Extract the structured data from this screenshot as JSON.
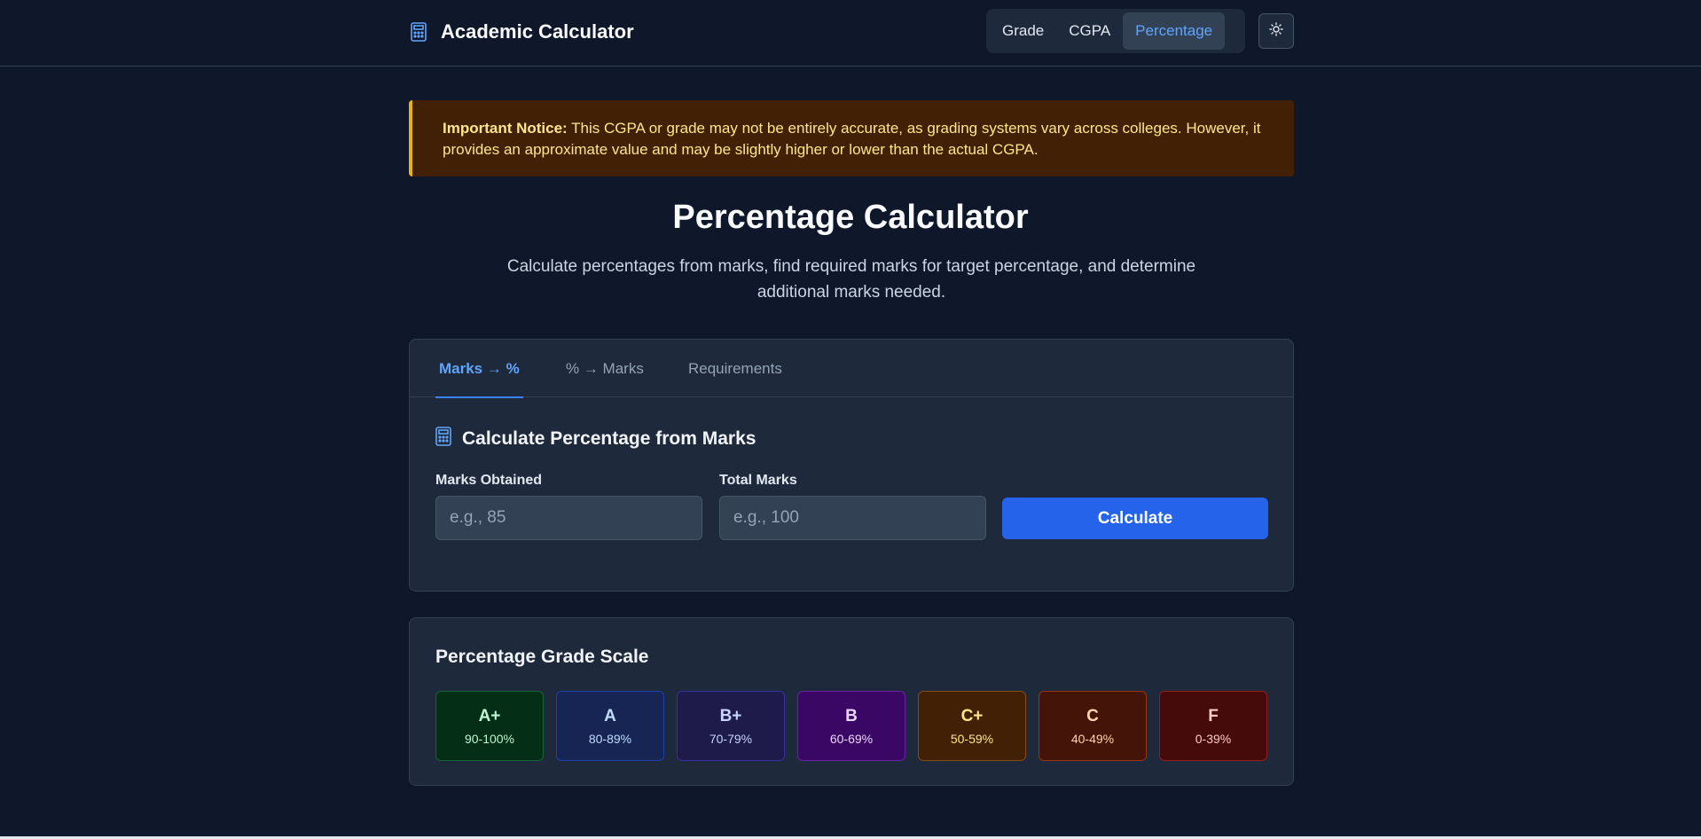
{
  "header": {
    "title": "Academic Calculator",
    "nav": [
      {
        "label": "Grade",
        "active": false
      },
      {
        "label": "CGPA",
        "active": false
      },
      {
        "label": "Percentage",
        "active": true
      }
    ],
    "theme_icon": "sun-icon"
  },
  "notice": {
    "label": "Important Notice:",
    "text": " This CGPA or grade may not be entirely accurate, as grading systems vary across colleges. However, it provides an approximate value and may be slightly higher or lower than the actual CGPA."
  },
  "page": {
    "title": "Percentage Calculator",
    "subtitle": "Calculate percentages from marks, find required marks for target percentage, and determine additional marks needed."
  },
  "calculator": {
    "tabs": [
      {
        "label": "Marks → %",
        "active": true
      },
      {
        "label": "% → Marks",
        "active": false
      },
      {
        "label": "Requirements",
        "active": false
      }
    ],
    "section_title": "Calculate Percentage from Marks",
    "marks_obtained_label": "Marks Obtained",
    "marks_obtained_placeholder": "e.g., 85",
    "marks_obtained_value": "",
    "total_marks_label": "Total Marks",
    "total_marks_placeholder": "e.g., 100",
    "total_marks_value": "",
    "calculate_label": "Calculate"
  },
  "scale": {
    "title": "Percentage Grade Scale",
    "grades": [
      {
        "grade": "A+",
        "range": "90-100%",
        "bg": "#052e16",
        "border": "#166534",
        "fg": "#bbf7d0"
      },
      {
        "grade": "A",
        "range": "80-89%",
        "bg": "#172554",
        "border": "#1e40af",
        "fg": "#bfdbfe"
      },
      {
        "grade": "B+",
        "range": "70-79%",
        "bg": "#1e1b4b",
        "border": "#3730a3",
        "fg": "#c7d2fe"
      },
      {
        "grade": "B",
        "range": "60-69%",
        "bg": "#3b0764",
        "border": "#6b21a8",
        "fg": "#e9d5ff"
      },
      {
        "grade": "C+",
        "range": "50-59%",
        "bg": "#422006",
        "border": "#854d0e",
        "fg": "#fde68a"
      },
      {
        "grade": "C",
        "range": "40-49%",
        "bg": "#431407",
        "border": "#9a3412",
        "fg": "#fed7aa"
      },
      {
        "grade": "F",
        "range": "0-39%",
        "bg": "#450a0a",
        "border": "#991b1b",
        "fg": "#fecaca"
      }
    ]
  },
  "colors": {
    "accent": "#60a5fa",
    "primary_button": "#2563eb",
    "notice_border": "#eab308"
  }
}
